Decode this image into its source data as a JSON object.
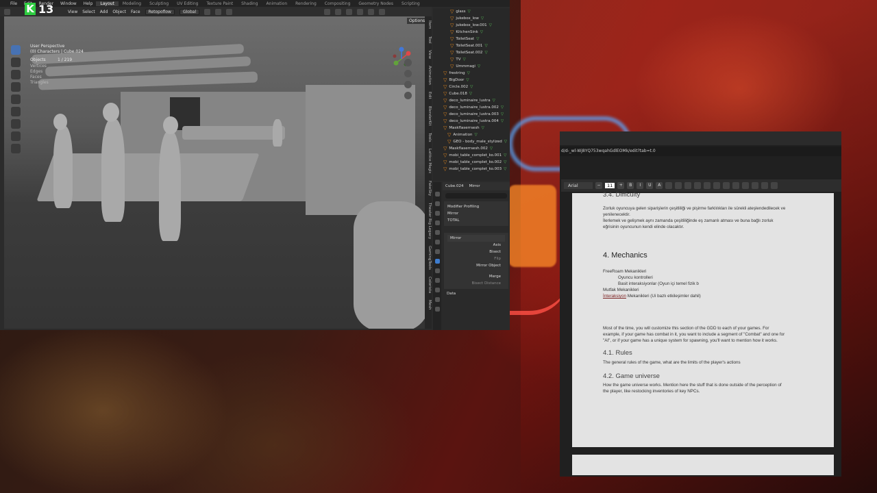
{
  "overlay": {
    "logo_letter": "K",
    "logo_number": "13"
  },
  "blender": {
    "menu": [
      "File",
      "Edit",
      "Render",
      "Window",
      "Help"
    ],
    "workspaces": [
      "Layout",
      "Modeling",
      "Sculpting",
      "UV Editing",
      "Texture Paint",
      "Shading",
      "Animation",
      "Rendering",
      "Compositing",
      "Geometry Nodes",
      "Scripting"
    ],
    "header": {
      "view": "View",
      "select": "Select",
      "add": "Add",
      "object": "Object",
      "face": "Face",
      "retopo": "Retopoflow",
      "orientation": "Global",
      "options": "Options"
    },
    "viewport": {
      "title": "User Perspective",
      "collection": "(0) Characters | Cube.024",
      "stats": [
        {
          "k": "Objects",
          "v": "1 / 219"
        },
        {
          "k": "Vertices",
          "v": ""
        },
        {
          "k": "Edges",
          "v": ""
        },
        {
          "k": "Faces",
          "v": ""
        },
        {
          "k": "Triangles",
          "v": ""
        }
      ]
    },
    "side_tabs": [
      "Item",
      "Tool",
      "View",
      "Animation",
      "Edit",
      "BlenderKit",
      "Tools",
      "Lattice Magic",
      "FakeSky",
      "Theater Rig Legacy",
      "GamingTools",
      "Colorista",
      "Mesh"
    ],
    "outliner": [
      "glass",
      "jukebox_low",
      "jukebox_low.001",
      "KitchenSink",
      "ToiletSeat",
      "ToiletSeat.001",
      "ToiletSeat.002",
      "TV",
      "Ummmagi",
      "frestring",
      "BigDoor",
      "Circle.002",
      "Cube.018",
      "deco_luminaire_lustra",
      "deco_luminaire_lustra.002",
      "deco_luminaire_lustra.003",
      "deco_luminaire_lustra.004",
      "Maskflaserrsesh",
      "Animation",
      "GEO - body_male_stylized",
      "Maskflaserrsesh.002",
      "mobi_table_complet_ko.001",
      "mobi_table_complet_ko.002",
      "mobi_table_complet_ko.003"
    ],
    "props": {
      "object": "Cube.024",
      "modifier": "Mirror",
      "profiling": "Modifier Profiling",
      "mirror_row": "Mirror",
      "total_row": "TOTAL",
      "mirror_name": "Mirror",
      "axis": "Axis",
      "bisect": "Bisect",
      "flip": "Flip",
      "mirror_object": "Mirror Object",
      "merge": "Merge",
      "bisect_distance": "Bisect Distance",
      "data": "Data"
    }
  },
  "browser": {
    "url": "d/d-_wl-Wj8YQ753wqahGdlEOMk/edit?tab=t.0",
    "font": "Arial",
    "font_size": "11",
    "doc": {
      "section_difficulty": "3.4. Difficulty",
      "difficulty_p1": "Zorluk oyuncuya gelen siparişlerin çeşitliliği ve pişirme farklılıkları ile sürekli ateşlendedilecek ve",
      "difficulty_p2": "yenilenecektir.",
      "difficulty_p3": "İlerlemek ve gelişmek aynı zamanda çeşitliliğinde eş zamanlı atması ve buna bağlı zorluk",
      "difficulty_p4": "eğrisinin oyuncunun kendi elinde olacaktır.",
      "mechanics_title": "4. Mechanics",
      "mech_l1": "FreeRoam Mekanikleri",
      "mech_l2": "Oyuncu kontrolleri",
      "mech_l3": "Basit interaksiyonlar (Oyun içi temel fizik b",
      "mech_l4": "Mutfak Mekanikleri",
      "mech_l5_link": "İnteraksiyon",
      "mech_l5_rest": " Mekanikleri (Ui bazlı etkileşimler dahil)",
      "gdd_p1": "Most of the time, you will customize this section of the GDD to each of your games. For",
      "gdd_p2": "example, if your game has combat in it, you want to include a segment of \"Combat\" and one for",
      "gdd_p3": "\"AI\", or if your game has a unique system for spawning, you'll want to mention how it works.",
      "rules_title": "4.1. Rules",
      "rules_p": "The general rules of the game, what are the limits of the player's actions",
      "universe_title": "4.2. Game universe",
      "universe_p1": "How the game universe works. Mention here the stuff that is done outside of the perception of",
      "universe_p2": "the player, like restocking inventories of key NPCs."
    }
  }
}
